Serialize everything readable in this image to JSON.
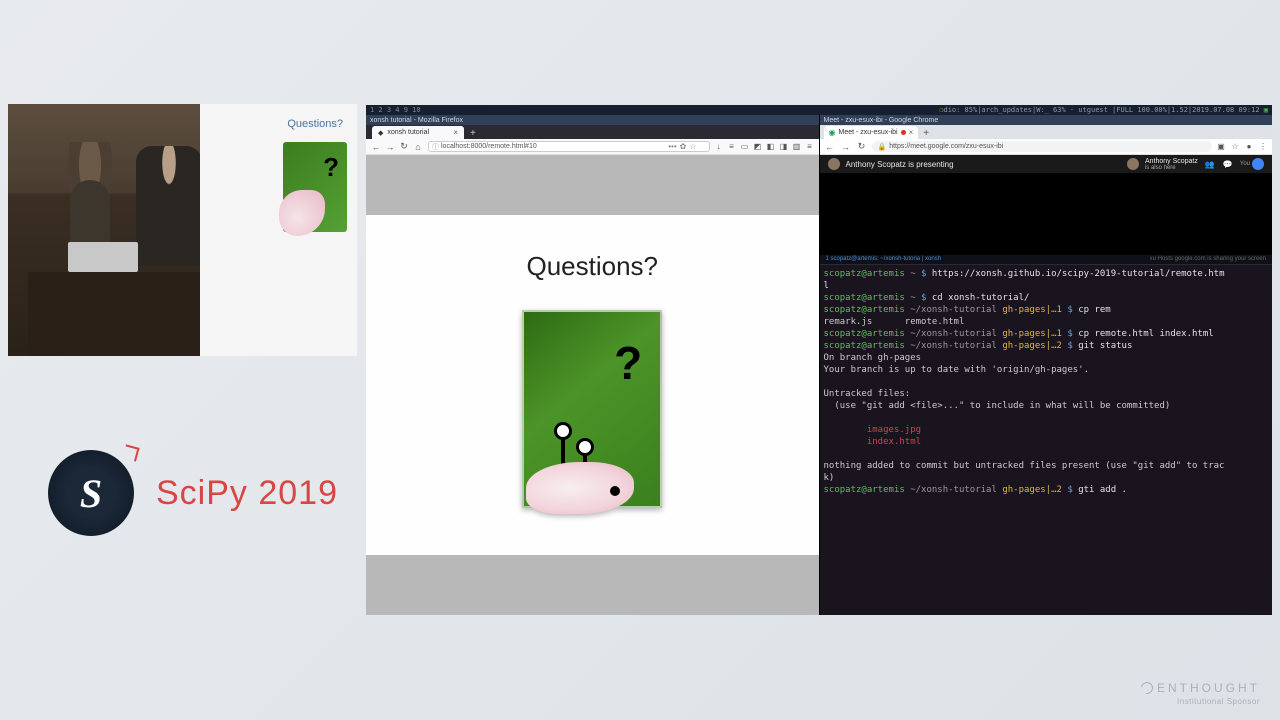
{
  "video": {
    "screen_title": "Questions?"
  },
  "logo": {
    "letter": "S",
    "text": "SciPy 2019"
  },
  "i3": {
    "workspaces": "1 2 3 4 9 10",
    "status": "dio: 85%|arch_updates|W:_ 63% - utguest |FULL 100.00%|1.52|2019.07.08 09:12"
  },
  "firefox": {
    "window_title": "xonsh tutorial - Mozilla Firefox",
    "tab": "xonsh tutorial",
    "url": "localhost:8000/remote.html#10",
    "slide_heading": "Questions?"
  },
  "chrome": {
    "window_title": "Meet - zxu-esux-ibi - Google Chrome",
    "tab": "Meet - zxu-esux-ibi",
    "url": "https://meet.google.com/zxu-esux-ibi",
    "presenting": "Anthony Scopatz is presenting",
    "also_here_name": "Anthony Scopatz",
    "also_here_sub": "is also here",
    "you": "You"
  },
  "term_tabs": {
    "left": "1 scopatz@artemis: ~/xonsh-tutoria | xonsh",
    "right": "xu Hosts google.com is sharing your screen"
  },
  "terminal": {
    "l1_user": "scopatz@artemis",
    "l1_path": "~",
    "l1_cmd": "https://xonsh.github.io/scipy-2019-tutorial/remote.htm",
    "l1b": "l",
    "l2_user": "scopatz@artemis",
    "l2_path": "~",
    "l2_cmd": "cd xonsh-tutorial/",
    "l3_user": "scopatz@artemis",
    "l3_path": "~/xonsh-tutorial",
    "l3_branch": "gh-pages|…1",
    "l3_cmd": "cp rem",
    "l3_out": "remark.js      remote.html",
    "l4_user": "scopatz@artemis",
    "l4_path": "~/xonsh-tutorial",
    "l4_branch": "gh-pages|…1",
    "l4_cmd": "cp remote.html index.html",
    "l5_user": "scopatz@artemis",
    "l5_path": "~/xonsh-tutorial",
    "l5_branch": "gh-pages|…2",
    "l5_cmd": "git status",
    "l5_out1": "On branch gh-pages",
    "l5_out2": "Your branch is up to date with 'origin/gh-pages'.",
    "l6_out1": "Untracked files:",
    "l6_out2": "  (use \"git add <file>...\" to include in what will be committed)",
    "l6_f1": "        images.jpg",
    "l6_f2": "        index.html",
    "l7_out": "nothing added to commit but untracked files present (use \"git add\" to trac\nk)",
    "l8_user": "scopatz@artemis",
    "l8_path": "~/xonsh-tutorial",
    "l8_branch": "gh-pages|…2",
    "l8_cmd": "gti add ."
  },
  "sponsor": {
    "name": "ENTHOUGHT",
    "sub": "Institutional Sponsor"
  }
}
